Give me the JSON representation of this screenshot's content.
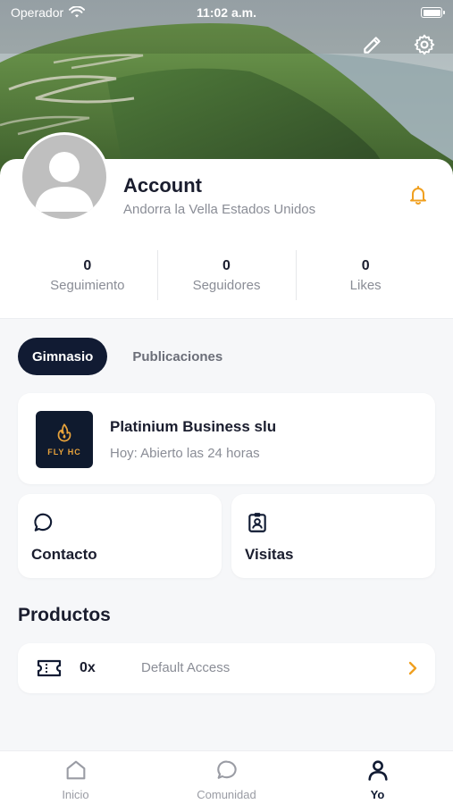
{
  "status_bar": {
    "carrier": "Operador",
    "time": "11:02 a.m."
  },
  "header": {
    "edit_icon": "pencil-icon",
    "settings_icon": "gear-icon"
  },
  "profile": {
    "name": "Account",
    "location": "Andorra la Vella Estados Unidos",
    "notification_icon": "bell-icon"
  },
  "stats": [
    {
      "value": "0",
      "label": "Seguimiento"
    },
    {
      "value": "0",
      "label": "Seguidores"
    },
    {
      "value": "0",
      "label": "Likes"
    }
  ],
  "tabs": [
    {
      "label": "Gimnasio",
      "active": true
    },
    {
      "label": "Publicaciones",
      "active": false
    }
  ],
  "business": {
    "name": "Platinium Business slu",
    "hours": "Hoy: Abierto las 24 horas",
    "logo_text": "FLY HC"
  },
  "actions": {
    "contact_label": "Contacto",
    "visits_label": "Visitas"
  },
  "products": {
    "title": "Productos",
    "items": [
      {
        "count": "0x",
        "name": "Default Access"
      }
    ]
  },
  "bottom_nav": [
    {
      "label": "Inicio",
      "icon": "home-icon",
      "active": false
    },
    {
      "label": "Comunidad",
      "icon": "chat-icon",
      "active": false
    },
    {
      "label": "Yo",
      "icon": "user-icon",
      "active": true
    }
  ],
  "colors": {
    "accent": "#f0a020",
    "navy": "#111b33",
    "muted": "#8a8d96"
  }
}
